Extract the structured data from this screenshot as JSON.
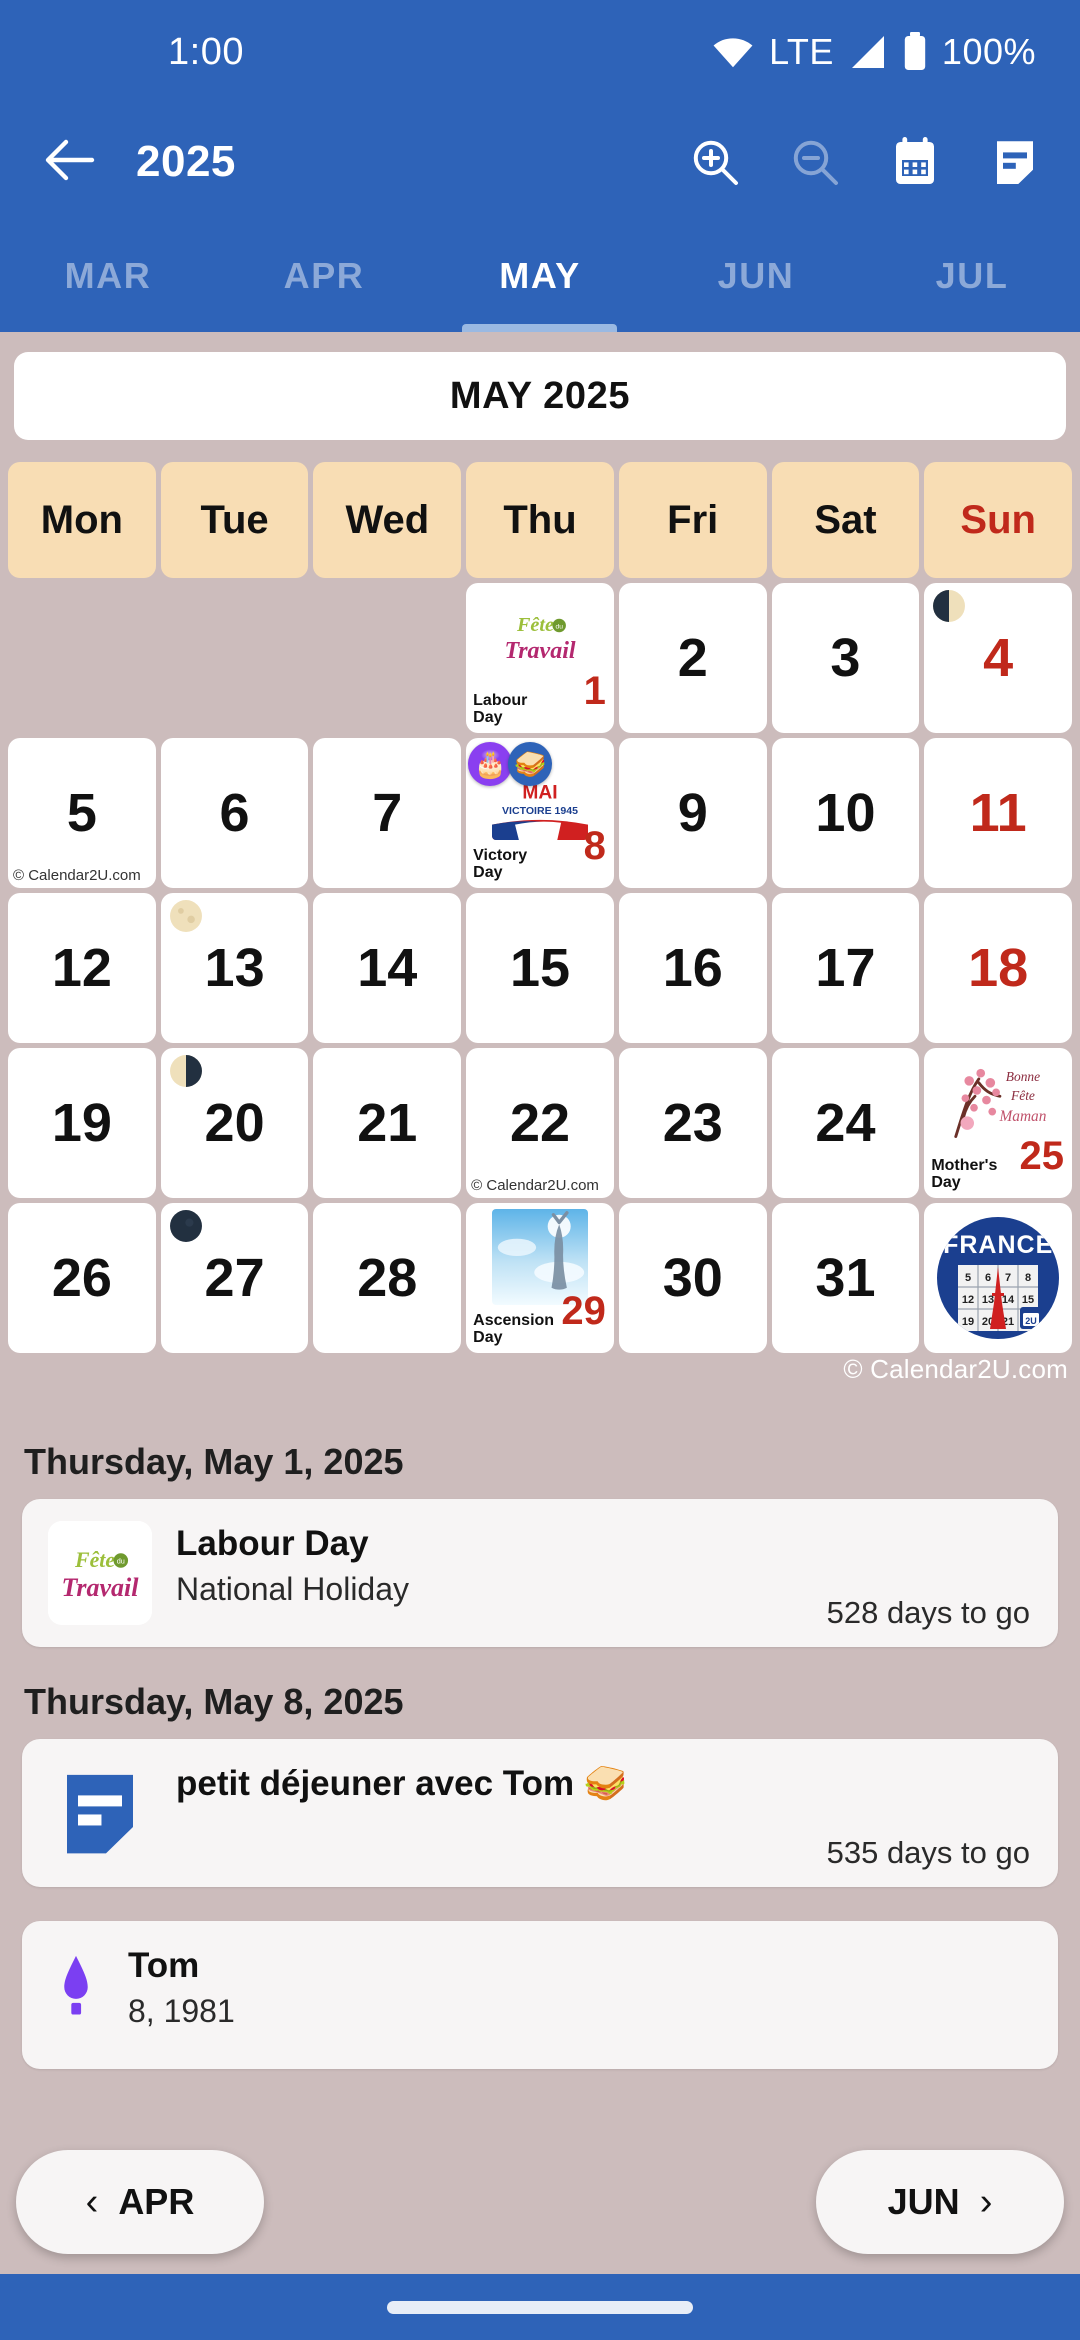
{
  "status_bar": {
    "time": "1:00",
    "network_label": "LTE",
    "battery_percent": "100%",
    "icons": [
      "wifi-icon",
      "cellular-signal-icon",
      "battery-icon"
    ]
  },
  "app_bar": {
    "back_icon": "back-arrow-icon",
    "title": "2025",
    "actions": [
      {
        "name": "zoom-in-icon",
        "label": "Zoom in",
        "enabled": true
      },
      {
        "name": "zoom-out-icon",
        "label": "Zoom out",
        "enabled": false
      },
      {
        "name": "calendar-icon",
        "label": "Calendar",
        "enabled": true
      },
      {
        "name": "note-icon",
        "label": "Notes",
        "enabled": true
      }
    ]
  },
  "month_tabs": {
    "items": [
      {
        "label": "MAR",
        "active": false
      },
      {
        "label": "APR",
        "active": false
      },
      {
        "label": "MAY",
        "active": true
      },
      {
        "label": "JUN",
        "active": false
      },
      {
        "label": "JUL",
        "active": false
      }
    ]
  },
  "calendar": {
    "title": "MAY 2025",
    "weekdays": [
      "Mon",
      "Tue",
      "Wed",
      "Thu",
      "Fri",
      "Sat",
      "Sun"
    ],
    "watermark": "© Calendar2U.com",
    "cell_watermark": "© Calendar2U.com",
    "country_badge": "FRANCE",
    "weeks": [
      [
        {
          "day": ""
        },
        {
          "day": ""
        },
        {
          "day": ""
        },
        {
          "day": "1",
          "holiday": true,
          "event_label": "Labour Day",
          "image": "fete-du-travail"
        },
        {
          "day": "2"
        },
        {
          "day": "3"
        },
        {
          "day": "4",
          "sunday": true,
          "moon": "last-quarter"
        }
      ],
      [
        {
          "day": "5",
          "watermark": true
        },
        {
          "day": "6"
        },
        {
          "day": "7"
        },
        {
          "day": "8",
          "holiday": true,
          "event_label": "Victory Day",
          "image": "victoire-1945",
          "emoji": [
            "🎂",
            "🥪"
          ]
        },
        {
          "day": "9"
        },
        {
          "day": "10"
        },
        {
          "day": "11",
          "sunday": true
        }
      ],
      [
        {
          "day": "12"
        },
        {
          "day": "13",
          "moon": "full"
        },
        {
          "day": "14"
        },
        {
          "day": "15"
        },
        {
          "day": "16"
        },
        {
          "day": "17"
        },
        {
          "day": "18",
          "sunday": true
        }
      ],
      [
        {
          "day": "19"
        },
        {
          "day": "20",
          "moon": "third-quarter"
        },
        {
          "day": "21"
        },
        {
          "day": "22",
          "watermark": true
        },
        {
          "day": "23"
        },
        {
          "day": "24"
        },
        {
          "day": "25",
          "sunday": true,
          "holiday": true,
          "event_label": "Mother's Day",
          "image": "bonne-fete-maman"
        }
      ],
      [
        {
          "day": "26"
        },
        {
          "day": "27",
          "moon": "new"
        },
        {
          "day": "28"
        },
        {
          "day": "29",
          "holiday": true,
          "event_label": "Ascension Day",
          "image": "ascension"
        },
        {
          "day": "30"
        },
        {
          "day": "31"
        },
        {
          "day": "",
          "country_badge": true
        }
      ]
    ]
  },
  "event_sections": [
    {
      "date_header": "Thursday, May 1, 2025",
      "events": [
        {
          "title": "Labour Day",
          "subtitle": "National Holiday",
          "countdown": "528 days to go",
          "thumb": "fete-du-travail"
        }
      ]
    },
    {
      "date_header": "Thursday, May 8, 2025",
      "events": [
        {
          "title": "petit déjeuner avec Tom 🥪",
          "subtitle": "",
          "countdown": "535 days to go",
          "thumb": "note-icon"
        },
        {
          "title": "Tom",
          "subtitle": "8, 1981",
          "countdown": "",
          "thumb": "candle-icon"
        }
      ]
    }
  ],
  "month_nav": {
    "prev_label": "APR",
    "prev_icon": "chevron-left-icon",
    "next_label": "JUN",
    "next_icon": "chevron-right-icon"
  },
  "colors": {
    "brand_blue": "#2e63b8",
    "page_background": "#ccbcbc",
    "weekday_header": "#f8ddb4",
    "holiday_red": "#c0291b",
    "card_white": "#ffffff"
  }
}
